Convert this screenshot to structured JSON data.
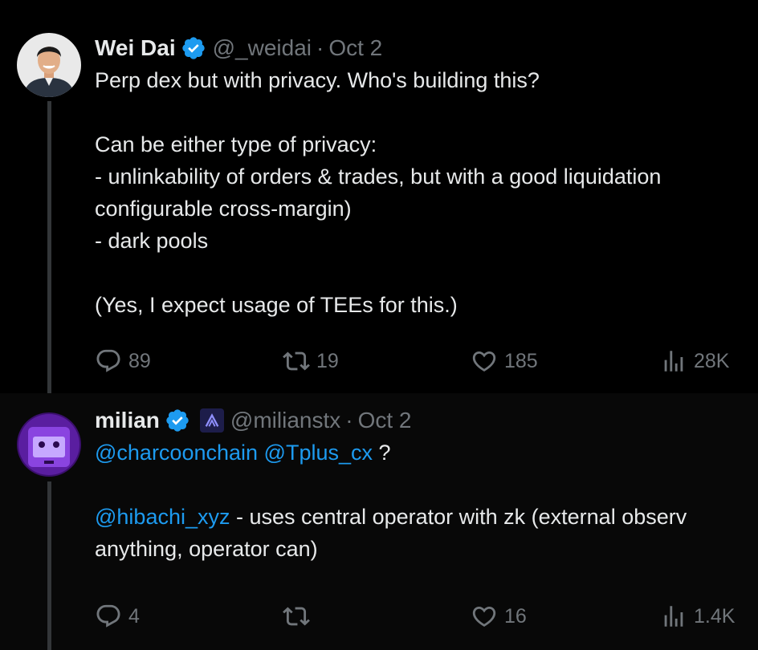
{
  "tweets": [
    {
      "author": {
        "name": "Wei Dai",
        "handle": "@_weidai",
        "date": "Oct 2",
        "verified": true
      },
      "lines": [
        "Perp dex but with privacy. Who's building this?",
        "",
        "Can be either type of privacy:",
        "- unlinkability of orders & trades, but with a good liquidation",
        "configurable cross-margin)",
        "- dark pools",
        "",
        "(Yes, I expect usage of TEEs for this.)"
      ],
      "stats": {
        "replies": "89",
        "retweets": "19",
        "likes": "185",
        "views": "28K"
      }
    },
    {
      "author": {
        "name": "milian",
        "handle": "@milianstx",
        "date": "Oct 2",
        "verified": true
      },
      "mentions": {
        "m1": "@charcoonchain",
        "m2": "@Tplus_cx",
        "m3": "@hibachi_xyz"
      },
      "text": {
        "q": "?",
        "l3_rest": " - uses central operator with zk (external observ",
        "l4": "anything, operator can)"
      },
      "stats": {
        "replies": "4",
        "retweets": "",
        "likes": "16",
        "views": "1.4K"
      }
    }
  ],
  "icons": {
    "reply": "reply-icon",
    "retweet": "retweet-icon",
    "like": "heart-icon",
    "views": "views-icon",
    "verified": "verified-badge-icon",
    "affiliate": "affiliate-badge-icon"
  },
  "colors": {
    "accent": "#1d9bf0",
    "muted": "#71767b",
    "text": "#e7e9ea"
  }
}
